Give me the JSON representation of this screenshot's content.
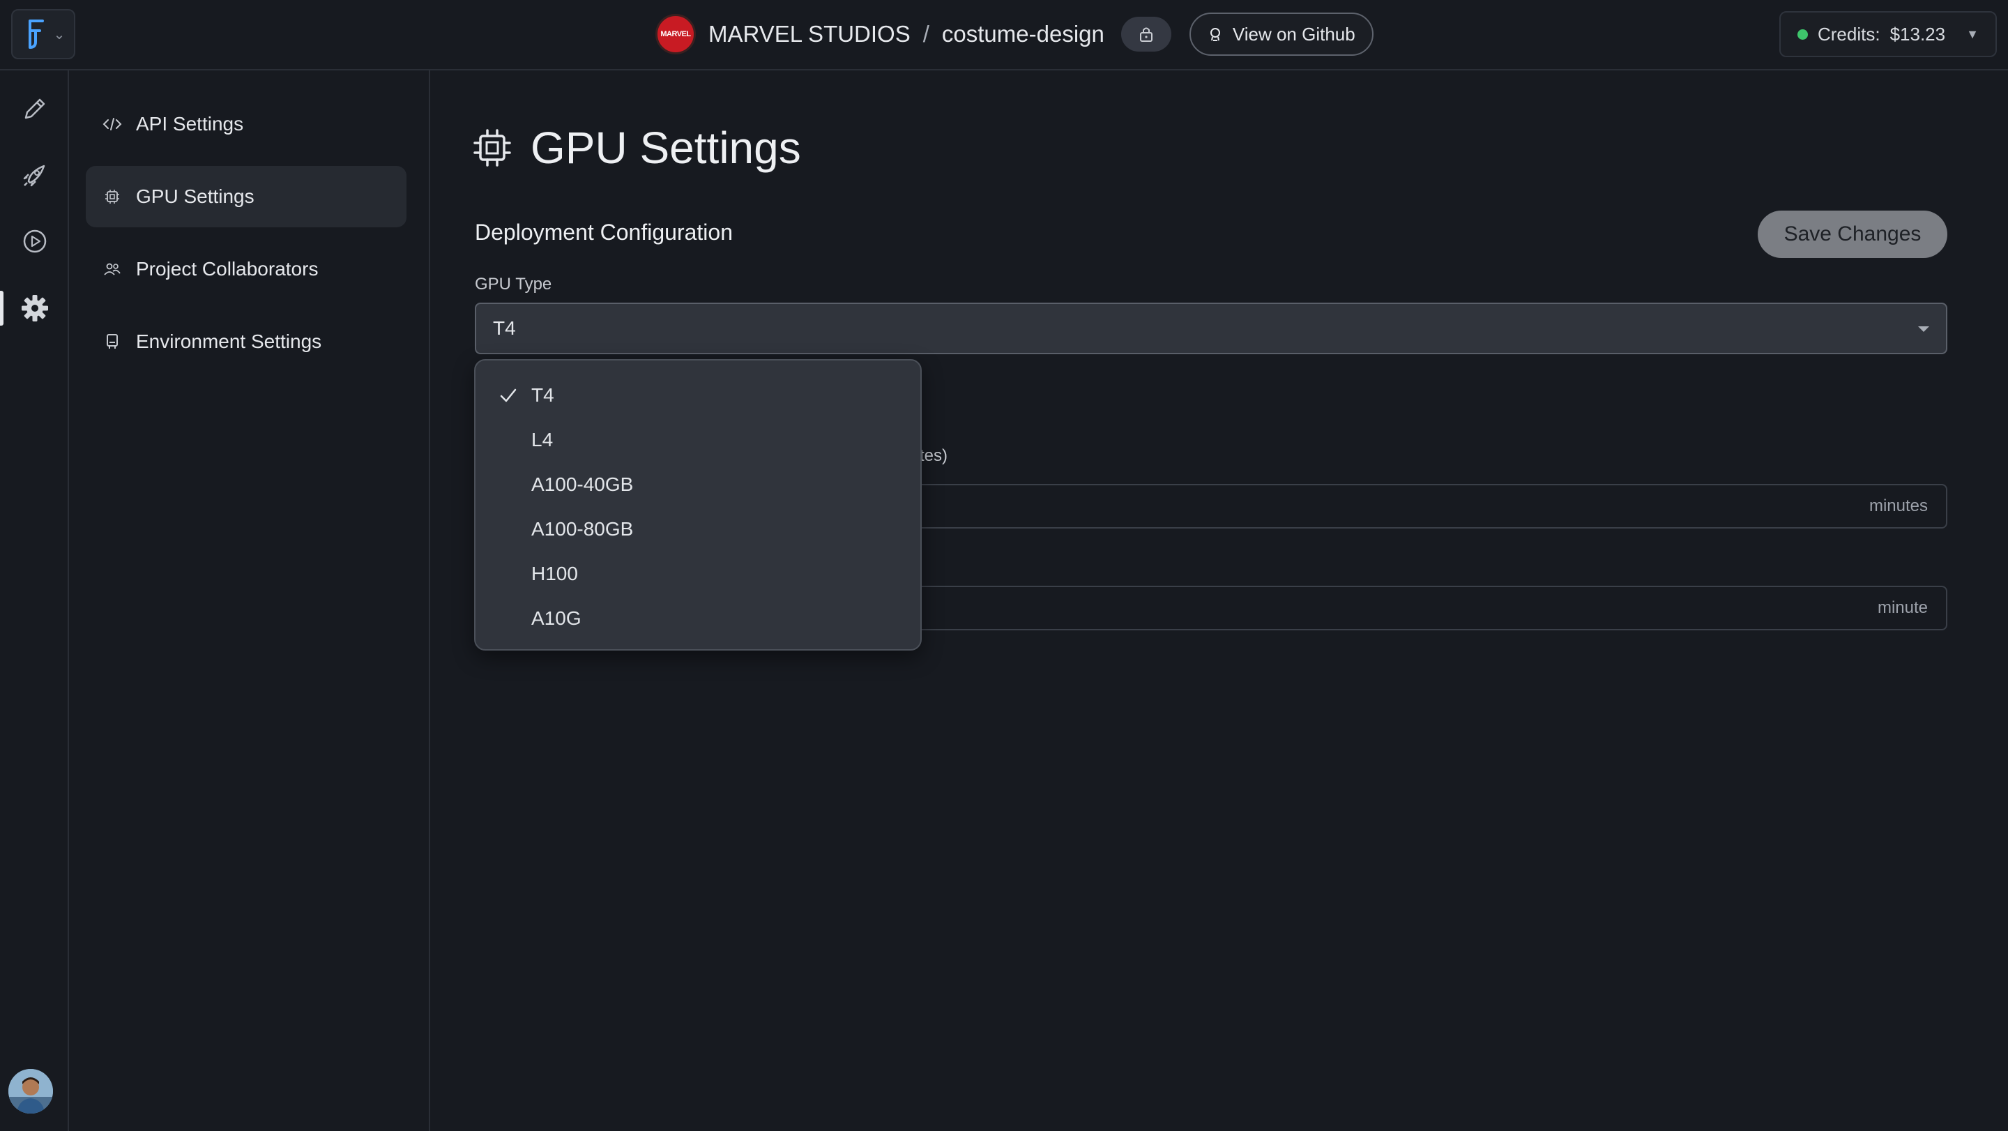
{
  "topbar": {
    "project_owner": "MARVEL STUDIOS",
    "separator": "/",
    "project_name": "costume-design",
    "badge_text": "MARVEL",
    "github_label": "View on Github",
    "credits_label": "Credits:",
    "credits_value": "$13.23"
  },
  "rail": {
    "items": [
      "pencil-icon",
      "rocket-icon",
      "play-icon",
      "gear-icon"
    ],
    "active": "gear-icon"
  },
  "subnav": {
    "items": [
      {
        "label": "API Settings",
        "icon": "code-icon"
      },
      {
        "label": "GPU Settings",
        "icon": "chip-icon",
        "active": true
      },
      {
        "label": "Project Collaborators",
        "icon": "users-icon"
      },
      {
        "label": "Environment Settings",
        "icon": "server-icon"
      }
    ]
  },
  "main": {
    "title": "GPU Settings",
    "section_title": "Deployment Configuration",
    "save_label": "Save Changes",
    "gpu_type_label": "GPU Type",
    "gpu_type_value": "T4",
    "hidden_label_fragment": "tes)",
    "field1_suffix": "minutes",
    "field2_suffix": "minute"
  },
  "dropdown": {
    "options": [
      "T4",
      "L4",
      "A100-40GB",
      "A100-80GB",
      "H100",
      "A10G"
    ],
    "selected": "T4"
  },
  "colors": {
    "background": "#171a20",
    "accent_green": "#3ec56b",
    "marvel_red": "#c81b23"
  }
}
